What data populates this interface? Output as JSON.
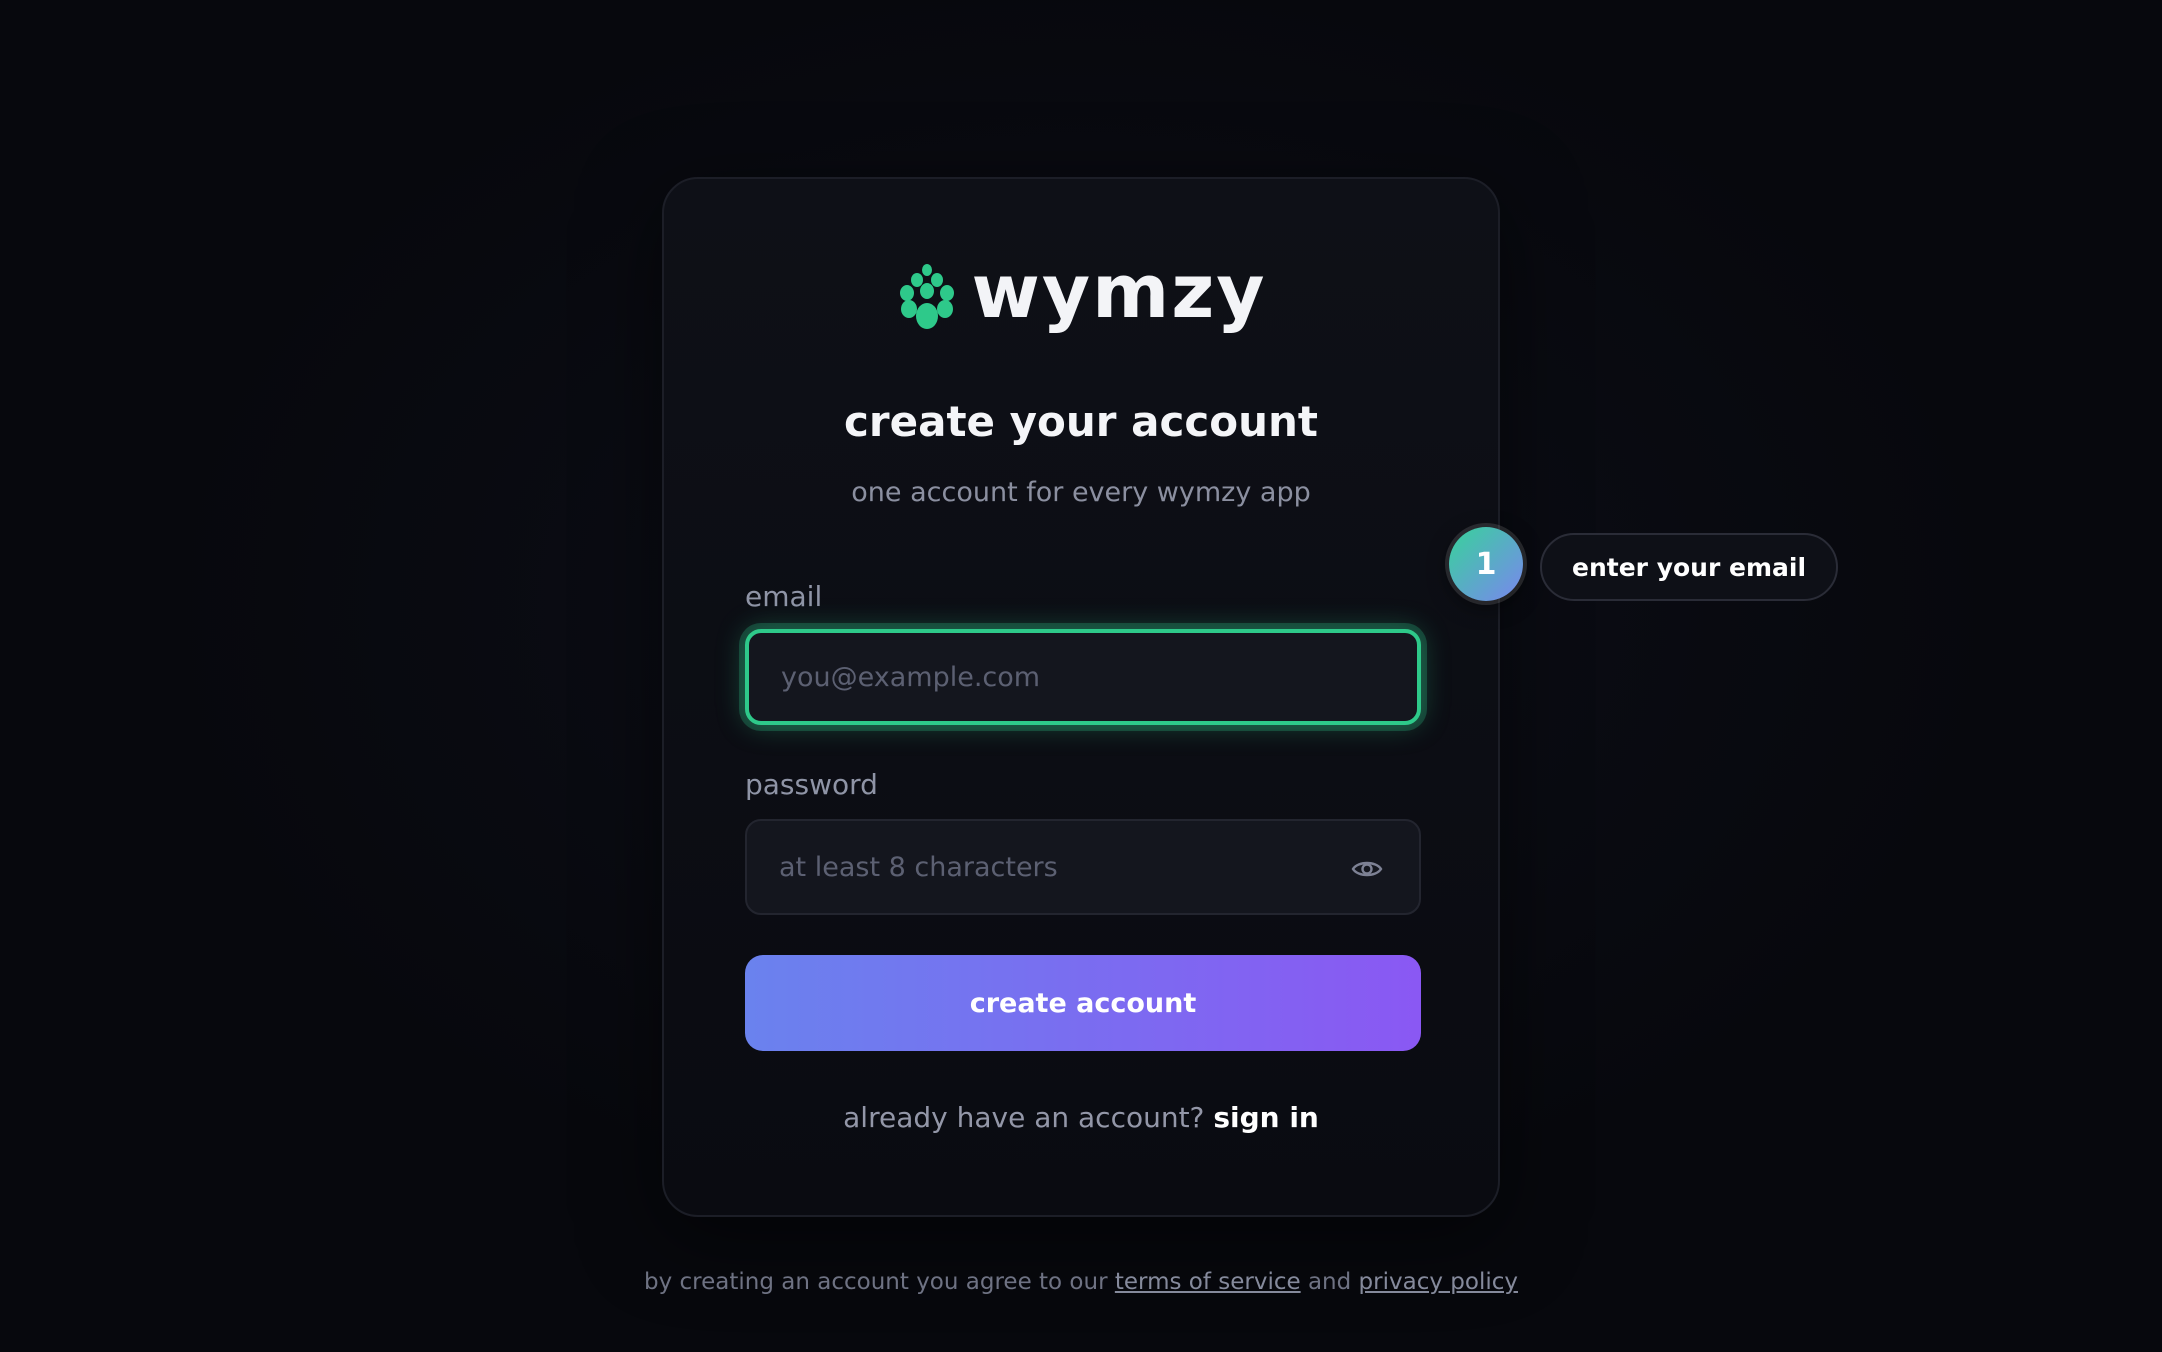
{
  "brand": {
    "name": "wymzy",
    "logo_icon": "pinecone-icon",
    "accent_color": "#2ec98a"
  },
  "form": {
    "title": "create your account",
    "subtitle": "one account for every wymzy app",
    "email": {
      "label": "email",
      "value": "",
      "placeholder": "you@example.com"
    },
    "password": {
      "label": "password",
      "value": "",
      "placeholder": "at least 8 characters",
      "toggle_icon": "eye-icon"
    },
    "submit_label": "create account",
    "gradient_start": "#6a82ee",
    "gradient_end": "#8a58f3",
    "signin_prompt": "already have an account?",
    "signin_link": "sign in"
  },
  "legal": {
    "prefix": "by creating an account you agree to our",
    "terms_link": "terms of service",
    "conjunction": "and",
    "privacy_link": "privacy policy"
  },
  "onboarding": {
    "step_number": "1",
    "tooltip": "enter your email"
  }
}
